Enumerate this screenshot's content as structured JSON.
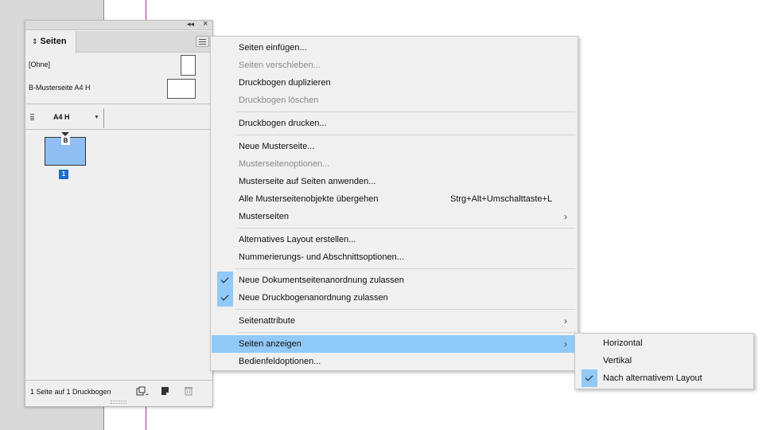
{
  "panel": {
    "tab_label": "Seiten",
    "tab_icon": "double-arrow-icon",
    "masters": [
      {
        "label": "[Ohne]"
      },
      {
        "label": "B-Musterseite A4 H"
      }
    ],
    "page_size": "A4 H",
    "page": {
      "master_prefix": "B",
      "number": "1"
    },
    "status": "1 Seite auf 1 Druckbogen",
    "colors": {
      "page_fill": "#8fbff2",
      "page_number_badge": "#1a6dd1"
    }
  },
  "menu": {
    "items": [
      {
        "label": "Seiten einfügen...",
        "enabled": true
      },
      {
        "label": "Seiten verschieben...",
        "enabled": false
      },
      {
        "label": "Druckbogen duplizieren",
        "enabled": true
      },
      {
        "label": "Druckbogen löschen",
        "enabled": false
      },
      {
        "label": "Druckbogen drucken...",
        "enabled": true
      },
      {
        "label": "Neue Musterseite...",
        "enabled": true
      },
      {
        "label": "Musterseitenoptionen...",
        "enabled": false
      },
      {
        "label": "Musterseite auf Seiten anwenden...",
        "enabled": true
      },
      {
        "label": "Alle Musterseitenobjekte übergehen",
        "shortcut": "Strg+Alt+Umschalttaste+L",
        "enabled": true
      },
      {
        "label": "Musterseiten",
        "submenu": true,
        "enabled": true
      },
      {
        "label": "Alternatives Layout erstellen...",
        "enabled": true
      },
      {
        "label": "Nummerierungs- und Abschnittsoptionen...",
        "enabled": true
      },
      {
        "label": "Neue Dokumentseitenanordnung zulassen",
        "checked": true,
        "enabled": true
      },
      {
        "label": "Neue Druckbogenanordnung zulassen",
        "checked": true,
        "enabled": true
      },
      {
        "label": "Seitenattribute",
        "submenu": true,
        "enabled": true
      },
      {
        "label": "Seiten anzeigen",
        "submenu": true,
        "highlighted": true,
        "enabled": true
      },
      {
        "label": "Bedienfeldoptionen...",
        "enabled": true
      }
    ],
    "arrow_glyph": "›",
    "highlight_color": "#91c9f7"
  },
  "submenu": {
    "items": [
      {
        "label": "Horizontal"
      },
      {
        "label": "Vertikal"
      },
      {
        "label": "Nach alternativem Layout",
        "checked": true
      }
    ]
  }
}
